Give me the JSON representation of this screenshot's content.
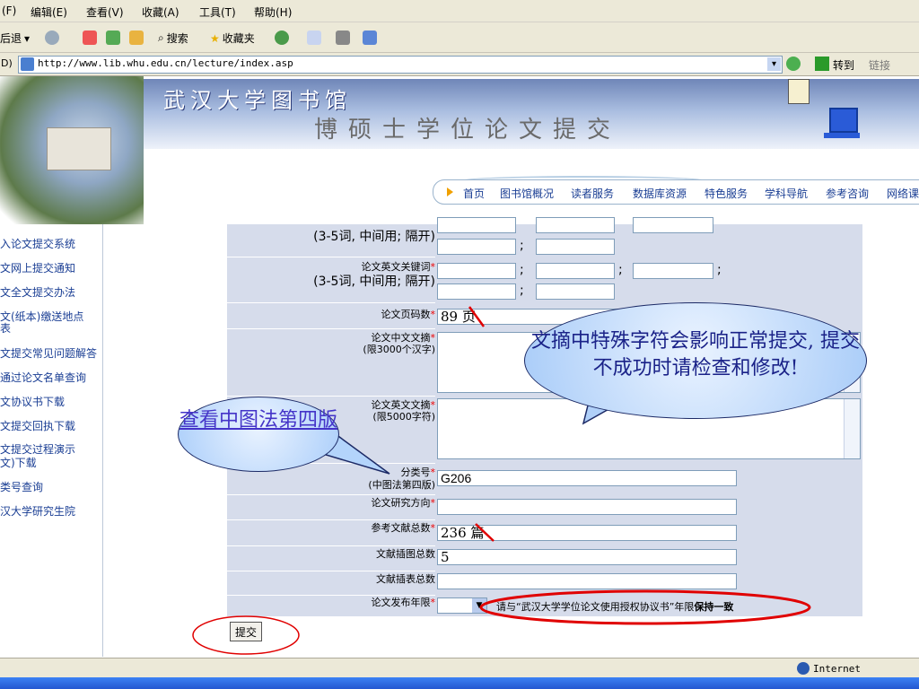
{
  "menu": [
    "(F)",
    "编辑(E)",
    "查看(V)",
    "收藏(A)",
    "工具(T)",
    "帮助(H)"
  ],
  "toolbar": {
    "back": "后退",
    "search": "搜索",
    "favorites": "收藏夹"
  },
  "address": {
    "label": "D)",
    "url": "http://www.lib.whu.edu.cn/lecture/index.asp",
    "go": "转到",
    "links": "链接"
  },
  "banner": {
    "title": "武汉大学图书馆",
    "subtitle": "博硕士学位论文提交"
  },
  "nav": [
    "首页",
    "图书馆概况",
    "读者服务",
    "数据库资源",
    "特色服务",
    "学科导航",
    "参考咨询",
    "网络课"
  ],
  "sidebar": [
    "入论文提交系统",
    "文网上提交通知",
    "文全文提交办法",
    "文(纸本)缴送地点",
    "表",
    "文提交常见问题解答",
    "通过论文名单查询",
    "文协议书下载",
    "文提交回执下载",
    "文提交过程演示",
    "文)下载",
    "类号查询",
    "汉大学研究生院"
  ],
  "form": {
    "kw_hint": "(3-5词, 中间用; 隔开)",
    "en_keywords": "论文英文关键词",
    "pages_label": "论文页码数",
    "pages_value": "89",
    "pages_unit": "页",
    "abstract_cn": "论文中文文摘",
    "abstract_cn_limit": "(限3000个汉字)",
    "abstract_en": "论文英文文摘",
    "abstract_en_limit": "(限5000字符)",
    "class_label": "分类号",
    "class_hint": "(中图法第四版)",
    "class_value": "G206",
    "direction": "论文研究方向",
    "refs_label": "参考文献总数",
    "refs_value": "236",
    "refs_unit": "篇",
    "figures": "文献插图总数",
    "figures_value": "5",
    "tables": "文献插表总数",
    "release": "论文发布年限",
    "release_note_a": "请与“武汉大学学位论文使用授权协议书”年限",
    "release_note_b": "保持一致",
    "submit": "提交",
    "semicolon": ";"
  },
  "callouts": {
    "clc": "查看中图法第四版",
    "note": "文摘中特殊字符会影响正常提交, 提交不成功时请检查和修改!"
  },
  "status": {
    "zone": "Internet"
  },
  "colors": {
    "nav_text": "#1a3e94",
    "required_star": "#ee0000",
    "highlight": "#e00000",
    "form_bg": "#d6dceb"
  }
}
